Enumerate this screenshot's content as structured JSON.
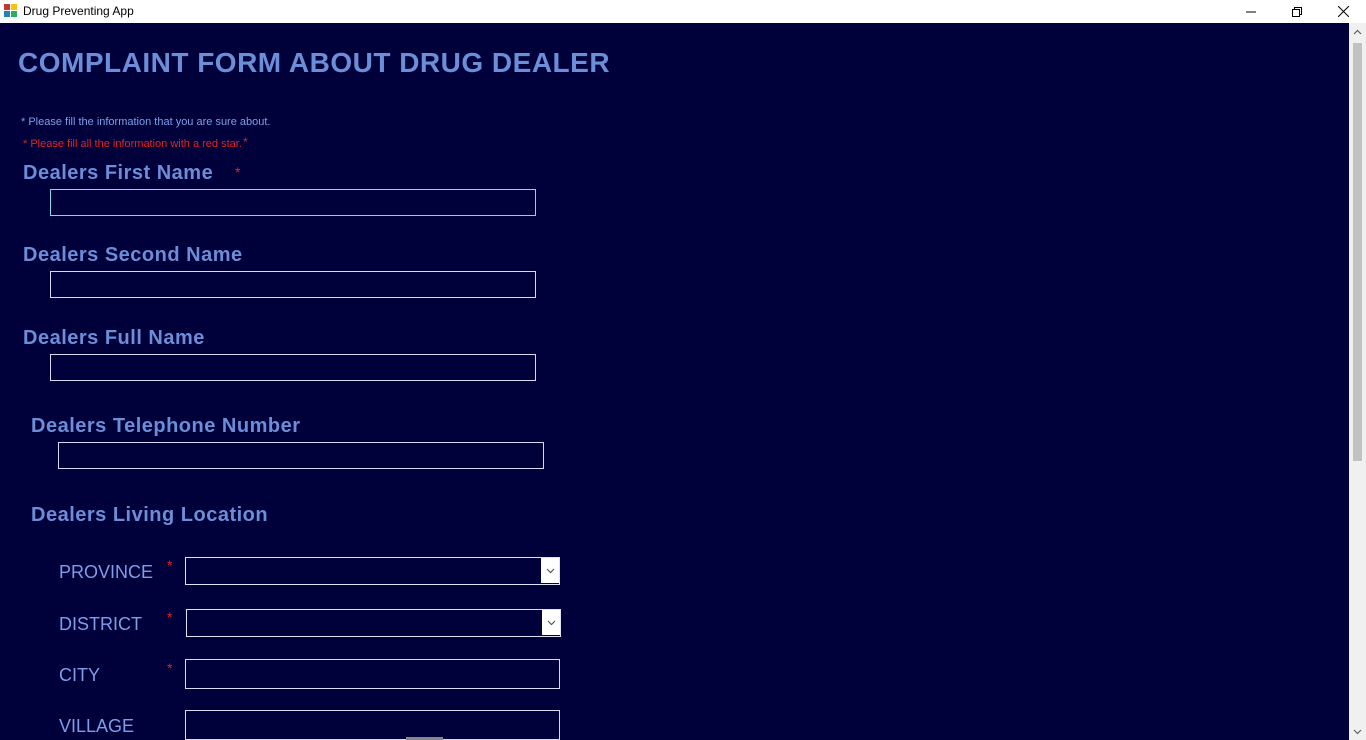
{
  "window": {
    "title": "Drug Preventing App",
    "minimize_glyph": "—",
    "maximize_glyph": "❐",
    "close_glyph": "✕"
  },
  "form": {
    "heading": "COMPLAINT FORM ABOUT DRUG DEALER",
    "note_sure": "* Please fill the information that you are sure about.",
    "note_required": "* Please fill all the information with a red star.",
    "note_required_star": "*",
    "fields": {
      "first_name": {
        "label": "Dealers First Name",
        "star": "*",
        "value": ""
      },
      "second_name": {
        "label": "Dealers Second Name",
        "value": ""
      },
      "full_name": {
        "label": "Dealers Full Name",
        "value": ""
      },
      "telephone": {
        "label": "Dealers Telephone Number",
        "value": ""
      }
    },
    "location": {
      "label": "Dealers Living Location",
      "province": {
        "label": "PROVINCE",
        "star": "*",
        "value": ""
      },
      "district": {
        "label": "DISTRICT",
        "star": "*",
        "value": ""
      },
      "city": {
        "label": "CITY",
        "star": "*",
        "value": ""
      },
      "village": {
        "label": "VILLAGE",
        "value": ""
      }
    }
  },
  "colors": {
    "background": "#00003a",
    "heading": "#6c8ed8",
    "required": "#e82020"
  }
}
